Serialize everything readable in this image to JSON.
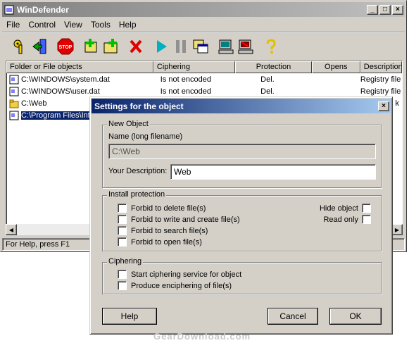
{
  "window": {
    "title": "WinDefender",
    "title_buttons": [
      "_",
      "□",
      "×"
    ]
  },
  "menu": [
    "File",
    "Control",
    "View",
    "Tools",
    "Help"
  ],
  "toolbar": {
    "icons": [
      "keys-icon",
      "exit-icon",
      "stop-icon",
      "add-file-icon",
      "add-folder-icon",
      "delete-icon",
      "play-icon",
      "pause-icon",
      "windows-icon",
      "computer-icon",
      "computer-blocked-icon",
      "help-icon"
    ],
    "stop_text": "STOP"
  },
  "list": {
    "columns": [
      "Folder or File objects",
      "Ciphering",
      "Protection",
      "Opens",
      "Description"
    ],
    "rows": [
      {
        "name": "C:\\WINDOWS\\system.dat",
        "ciphering": "Is not encoded",
        "protection": "Del.",
        "opens": "",
        "description": "Registry file",
        "icon": "file-icon"
      },
      {
        "name": "C:\\WINDOWS\\user.dat",
        "ciphering": "Is not encoded",
        "protection": "Del.",
        "opens": "",
        "description": "Registry file",
        "icon": "file-icon"
      },
      {
        "name": "C:\\Web",
        "ciphering": "",
        "protection": "",
        "opens": "",
        "description": "k",
        "icon": "folder-icon"
      },
      {
        "name": "C:\\Program Files\\Inte",
        "ciphering": "",
        "protection": "",
        "opens": "",
        "description": "",
        "icon": "file-icon"
      }
    ]
  },
  "status": "For Help, press F1",
  "dialog": {
    "title": "Settings for the object",
    "close": "×",
    "new_object": {
      "label": "New Object",
      "name_label": "Name (long filename)",
      "name_value": "C:\\Web",
      "desc_label": "Your Description:",
      "desc_value": "Web"
    },
    "install": {
      "label": "Install protection",
      "options": [
        "Forbid to delete file(s)",
        "Forbid to write and create file(s)",
        "Forbid to search file(s)",
        "Forbid to open file(s)"
      ],
      "hide_object": "Hide object",
      "read_only": "Read only"
    },
    "ciphering": {
      "label": "Ciphering",
      "options": [
        "Start ciphering service for object",
        "Produce enciphering of file(s)"
      ]
    },
    "buttons": {
      "help": "Help",
      "cancel": "Cancel",
      "ok": "OK"
    }
  },
  "watermark": "GearDownload.com"
}
